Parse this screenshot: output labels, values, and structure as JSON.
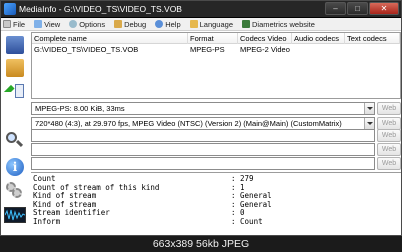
{
  "window": {
    "title": "MediaInfo - G:\\VIDEO_TS\\VIDEO_TS.VOB"
  },
  "menu": [
    {
      "label": "File",
      "icon": "file-icon"
    },
    {
      "label": "View",
      "icon": "view-icon"
    },
    {
      "label": "Options",
      "icon": "options-icon"
    },
    {
      "label": "Debug",
      "icon": "debug-icon"
    },
    {
      "label": "Help",
      "icon": "help-icon"
    },
    {
      "label": "Language",
      "icon": "language-icon"
    },
    {
      "label": "Diametrics website",
      "icon": "website-icon"
    }
  ],
  "filelist": {
    "columns": [
      "Complete name",
      "Format",
      "Codecs Video",
      "Audio codecs",
      "Text codecs"
    ],
    "rows": [
      {
        "cells": [
          "G:\\VIDEO_TS\\VIDEO_TS.VOB",
          "MPEG-PS",
          "MPEG-2 Video",
          "",
          ""
        ]
      }
    ]
  },
  "streams": [
    {
      "text": "MPEG-PS: 8.00 KiB, 33ms",
      "web": "Web"
    },
    {
      "text": "720*480 (4:3), at 29.970 fps, MPEG Video (NTSC) (Version 2) (Main@Main) (CustomMatrix)",
      "web": "Web"
    },
    {
      "text": "",
      "web": "Web"
    },
    {
      "text": "",
      "web": "Web"
    },
    {
      "text": "",
      "web": "Web"
    }
  ],
  "info": [
    {
      "key": "Count",
      "value": ": 279"
    },
    {
      "key": "Count of stream of this kind",
      "value": ": 1"
    },
    {
      "key": "Kind of stream",
      "value": ": General"
    },
    {
      "key": "Kind of stream",
      "value": ": General"
    },
    {
      "key": "Stream identifier",
      "value": ": 0"
    },
    {
      "key": "Inform",
      "value": ": Count"
    }
  ],
  "caption": "663x389 56kb JPEG",
  "colors": {
    "titlebar": "#262626",
    "menubar": "#f0f0f0",
    "close": "#a8241a",
    "background": "#1b1b1b"
  }
}
